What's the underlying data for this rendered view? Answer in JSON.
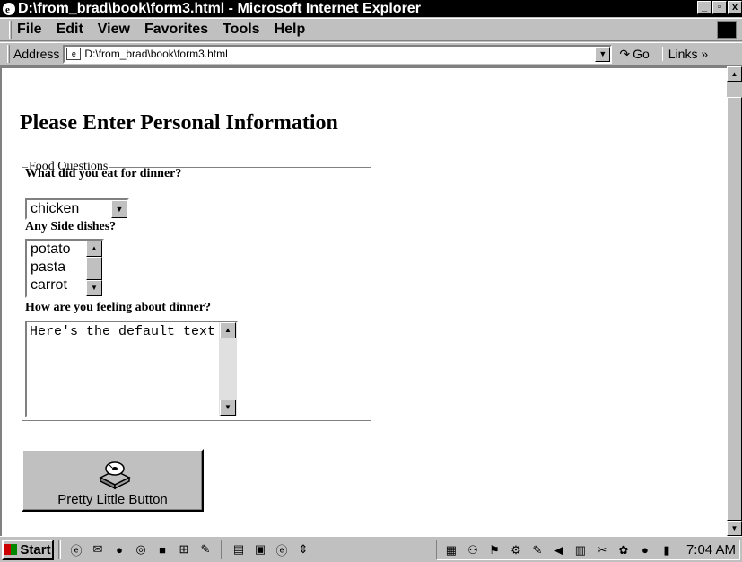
{
  "window": {
    "title": "D:\\from_brad\\book\\form3.html - Microsoft Internet Explorer",
    "controls": [
      "_",
      "▫",
      "x"
    ]
  },
  "menu": {
    "items": [
      {
        "label": "File"
      },
      {
        "label": "Edit"
      },
      {
        "label": "View"
      },
      {
        "label": "Favorites"
      },
      {
        "label": "Tools"
      },
      {
        "label": "Help"
      }
    ]
  },
  "addressbar": {
    "label": "Address",
    "url": "D:\\from_brad\\book\\form3.html",
    "go_label": "Go",
    "links_label": "Links »"
  },
  "page": {
    "title": "Please Enter Personal Information",
    "fieldset_legend": "Food Questions",
    "q1": "What did you eat for dinner?",
    "q1_selected": "chicken",
    "q2": "Any Side dishes?",
    "q2_options": [
      "potato",
      "pasta",
      "carrot"
    ],
    "q3": "How are you feeling about dinner?",
    "q3_text": "Here's the default text",
    "button_label": "Pretty Little Button"
  },
  "taskbar": {
    "start_label": "Start",
    "clock": "7:04 AM"
  }
}
